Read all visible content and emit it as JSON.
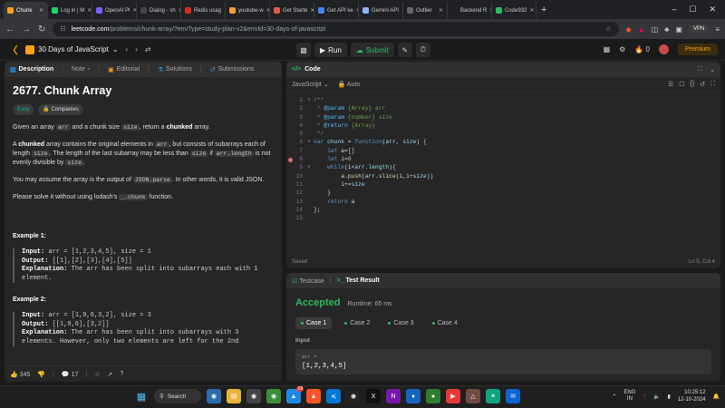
{
  "browser": {
    "tabs": [
      {
        "label": "Chunk",
        "color": "#ffa116",
        "active": true
      },
      {
        "label": "Log in | M",
        "color": "#25d366"
      },
      {
        "label": "OpenAI Pl",
        "color": "#7b61ff"
      },
      {
        "label": "Dialog - sh",
        "color": "#444444"
      },
      {
        "label": "Redis usag",
        "color": "#d82c20"
      },
      {
        "label": "youtube-w",
        "color": "#f0a030"
      },
      {
        "label": "Get Starte",
        "color": "#e05d44"
      },
      {
        "label": "Get API ke",
        "color": "#4285f4"
      },
      {
        "label": "Gemini API",
        "color": "#8ab4f8"
      },
      {
        "label": "Outlier",
        "color": "#666666"
      },
      {
        "label": "Backend R",
        "color": "#222222"
      },
      {
        "label": "Code932",
        "color": "#2cbb5d"
      }
    ],
    "new_tab": "+",
    "url_host": "leetcode.com",
    "url_path": "/problems/chunk-array/?envType=study-plan-v2&envId=30-days-of-javascript",
    "vpn": "VPN"
  },
  "navbar": {
    "plan_title": "30 Days of JavaScript",
    "run_label": "Run",
    "submit_label": "Submit",
    "streak": "0",
    "premium_label": "Premium"
  },
  "left_tabs": {
    "description": "Description",
    "note": "Note",
    "editorial": "Editorial",
    "solutions": "Solutions",
    "submissions": "Submissions"
  },
  "problem": {
    "title": "2677. Chunk Array",
    "difficulty": "Easy",
    "companies": "Companies",
    "p1_a": "Given an array ",
    "p1_code1": "arr",
    "p1_b": " and a chunk size ",
    "p1_code2": "size",
    "p1_c": ", return a ",
    "p1_bold": "chunked",
    "p1_d": " array.",
    "p2_a": "A ",
    "p2_bold": "chunked",
    "p2_b": " array contains the original elements in ",
    "p2_code1": "arr",
    "p2_c": ", but consists of subarrays each of length ",
    "p2_code2": "size",
    "p2_d": ". The length of the last subarray may be less than ",
    "p2_code3": "size",
    "p2_e": " if ",
    "p2_code4": "arr.length",
    "p2_f": " is not evenly divisible by ",
    "p2_code5": "size",
    "p2_g": ".",
    "p3_a": "You may assume the array is the output of ",
    "p3_code": "JSON.parse",
    "p3_b": ". In other words, it is valid JSON.",
    "p4_a": "Please solve it without using lodash's ",
    "p4_code": "_.chunk",
    "p4_b": " function.",
    "ex1_title": "Example 1:",
    "ex1_input_k": "Input:",
    "ex1_input": " arr = [1,2,3,4,5], size = 1",
    "ex1_output_k": "Output:",
    "ex1_output": " [[1],[2],[3],[4],[5]]",
    "ex1_expl_k": "Explanation:",
    "ex1_expl": " The arr has been split into subarrays each with 1 element.",
    "ex2_title": "Example 2:",
    "ex2_input_k": "Input:",
    "ex2_input": " arr = [1,9,6,3,2], size = 3",
    "ex2_output_k": "Output:",
    "ex2_output": " [[1,9,6],[3,2]]",
    "ex2_expl_k": "Explanation:",
    "ex2_expl": " The arr has been split into subarrays with 3 elements. However, only two elements are left for the 2nd"
  },
  "left_footer": {
    "likes": "345",
    "comments": "17"
  },
  "code_panel": {
    "title": "Code",
    "language": "JavaScript",
    "auto": "Auto",
    "saved": "Saved",
    "cursor": "Ln 5, Col 4"
  },
  "code_lines": [
    {
      "n": "1",
      "t": "/**"
    },
    {
      "n": "2",
      "t": " * @param {Array} arr"
    },
    {
      "n": "3",
      "t": " * @param {number} size"
    },
    {
      "n": "4",
      "t": " * @return {Array}"
    },
    {
      "n": "5",
      "t": " */"
    },
    {
      "n": "6",
      "t": "var chunk = function(arr, size) {"
    },
    {
      "n": "7",
      "t": "    let a=[]"
    },
    {
      "n": "8",
      "t": "    let i=0"
    },
    {
      "n": "9",
      "t": "    while(i<arr.length){"
    },
    {
      "n": "10",
      "t": "        a.push(arr.slice(i,i+size))"
    },
    {
      "n": "11",
      "t": "        i+=size"
    },
    {
      "n": "12",
      "t": "    }"
    },
    {
      "n": "13",
      "t": "    return a"
    },
    {
      "n": "14",
      "t": "};"
    },
    {
      "n": "15",
      "t": ""
    }
  ],
  "test_panel": {
    "testcase_tab": "Testcase",
    "result_tab": "Test Result",
    "status": "Accepted",
    "runtime": "Runtime: 65 ms",
    "cases": [
      "Case 1",
      "Case 2",
      "Case 3",
      "Case 4"
    ],
    "input_label": "Input",
    "input_name": "arr =",
    "input_value": "[1,2,3,4,5]"
  },
  "taskbar": {
    "search": "Search",
    "lang1": "ENG",
    "lang2": "IN",
    "time": "10:25:12",
    "date": "12-10-2024",
    "notif_count": "19"
  },
  "colors": {
    "accent": "#ffa116",
    "accepted": "#2cbb5d",
    "easy": "#00b8a3"
  }
}
